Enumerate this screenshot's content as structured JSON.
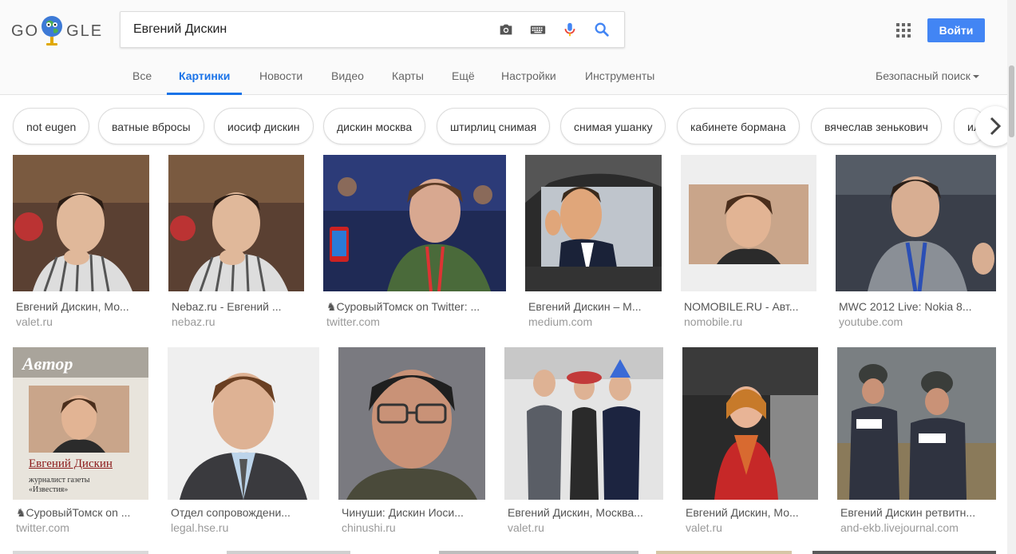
{
  "search": {
    "query": "Евгений Дискин"
  },
  "header": {
    "logo_text_left": "GO",
    "logo_text_right": "GLE",
    "login_label": "Войти"
  },
  "tabs": [
    {
      "label": "Все"
    },
    {
      "label": "Картинки",
      "active": true
    },
    {
      "label": "Новости"
    },
    {
      "label": "Видео"
    },
    {
      "label": "Карты"
    },
    {
      "label": "Ещё"
    },
    {
      "label": "Настройки"
    },
    {
      "label": "Инструменты"
    }
  ],
  "safe_search_label": "Безопасный поиск",
  "chips": [
    "not eugen",
    "ватные вбросы",
    "иосиф дискин",
    "дискин москва",
    "штирлиц снимая",
    "снимая ушанку",
    "кабинете бормана",
    "вячеслав зенькович",
    "ильич"
  ],
  "results_row1": [
    {
      "title": "Евгений Дискин, Мо...",
      "site": "valet.ru"
    },
    {
      "title": "Nebaz.ru - Евгений ...",
      "site": "nebaz.ru"
    },
    {
      "title": "♞СуровыйТомск on Twitter: ...",
      "site": "twitter.com"
    },
    {
      "title": "Евгений Дискин – M...",
      "site": "medium.com"
    },
    {
      "title": "NOMOBILE.RU - Авт...",
      "site": "nomobile.ru"
    },
    {
      "title": "MWC 2012 Live: Nokia 8...",
      "site": "youtube.com"
    }
  ],
  "results_row2": [
    {
      "title": "♞СуровыйТомск on ...",
      "site": "twitter.com",
      "book_top": "Автор",
      "book_name": "Евгений Дискин",
      "book_caption_1": "журналист газеты",
      "book_caption_2": "«Известия»"
    },
    {
      "title": "Отдел сопровождени...",
      "site": "legal.hse.ru"
    },
    {
      "title": "Чинуши: Дискин Иоси...",
      "site": "chinushi.ru"
    },
    {
      "title": "Евгений Дискин, Москва...",
      "site": "valet.ru"
    },
    {
      "title": "Евгений Дискин, Мо...",
      "site": "valet.ru"
    },
    {
      "title": "Евгений Дискин ретвитн...",
      "site": "and-ekb.livejournal.com"
    }
  ],
  "colors": {
    "accent": "#1a73e8",
    "button": "#4285f4"
  }
}
